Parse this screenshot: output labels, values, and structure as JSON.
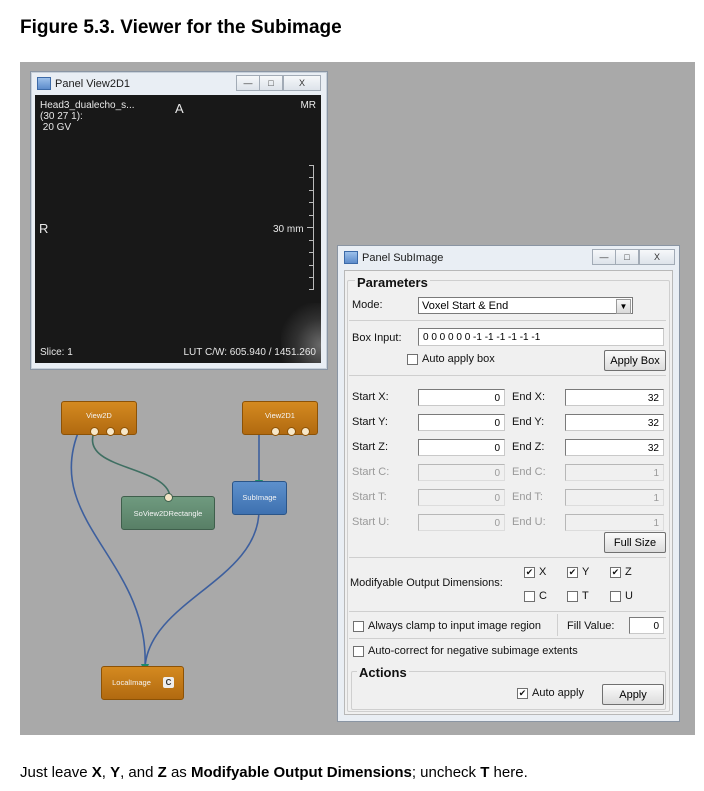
{
  "figure": {
    "title": "Figure 5.3. Viewer for the Subimage"
  },
  "view_window": {
    "title": "Panel View2D1",
    "btn_min": "—",
    "btn_max": "□",
    "btn_close": "X",
    "overlay": {
      "top_left": "Head3_dualecho_s...",
      "coords": "(30 27 1):",
      "value": " 20 GV",
      "top_center": "A",
      "top_right": "MR",
      "left": "R",
      "scale": "30 mm",
      "slice": "Slice: 1",
      "lut": "LUT C/W: 605.940 / 1451.260"
    }
  },
  "network": {
    "view2d": "View2D",
    "view2d1": "View2D1",
    "rectangle": "SoView2DRectangle",
    "subimage": "SubImage",
    "localimage": "LocalImage",
    "reload_icon": "C"
  },
  "panel": {
    "title": "Panel SubImage",
    "btn_min": "—",
    "btn_max": "□",
    "btn_close": "X",
    "parameters": "Parameters",
    "mode_label": "Mode:",
    "mode_value": "Voxel Start & End",
    "box_input_label": "Box Input:",
    "box_input_value": "0 0 0 0 0 0 -1 -1 -1 -1 -1 -1",
    "auto_apply_box": "Auto apply box",
    "auto_apply_box_checked": false,
    "apply_box": "Apply Box",
    "rows": [
      {
        "start_label": "Start X:",
        "start": "0",
        "end_label": "End X:",
        "end": "32",
        "enabled": true
      },
      {
        "start_label": "Start Y:",
        "start": "0",
        "end_label": "End Y:",
        "end": "32",
        "enabled": true
      },
      {
        "start_label": "Start Z:",
        "start": "0",
        "end_label": "End Z:",
        "end": "32",
        "enabled": true
      },
      {
        "start_label": "Start C:",
        "start": "0",
        "end_label": "End C:",
        "end": "1",
        "enabled": false
      },
      {
        "start_label": "Start T:",
        "start": "0",
        "end_label": "End T:",
        "end": "1",
        "enabled": false
      },
      {
        "start_label": "Start U:",
        "start": "0",
        "end_label": "End U:",
        "end": "1",
        "enabled": false
      }
    ],
    "full_size": "Full Size",
    "modifyable_label": "Modifyable Output Dimensions:",
    "dims": [
      {
        "label": "X",
        "checked": true
      },
      {
        "label": "Y",
        "checked": true
      },
      {
        "label": "Z",
        "checked": true
      },
      {
        "label": "C",
        "checked": false
      },
      {
        "label": "T",
        "checked": false
      },
      {
        "label": "U",
        "checked": false
      }
    ],
    "clamp_label": "Always clamp to input image region",
    "fill_value_label": "Fill Value:",
    "fill_value": "0",
    "autocorrect_label": "Auto-correct for negative subimage extents",
    "actions": "Actions",
    "auto_apply": "Auto apply",
    "auto_apply_checked": true,
    "apply": "Apply",
    "check_mark": "✔"
  },
  "caption": {
    "p1": "Just leave ",
    "x": "X",
    "p2": ", ",
    "y": "Y",
    "p3": ", and ",
    "z": "Z",
    "p4": " as ",
    "dims": "Modifyable Output Dimensions",
    "p5": "; uncheck ",
    "t": "T",
    "p6": " here."
  }
}
